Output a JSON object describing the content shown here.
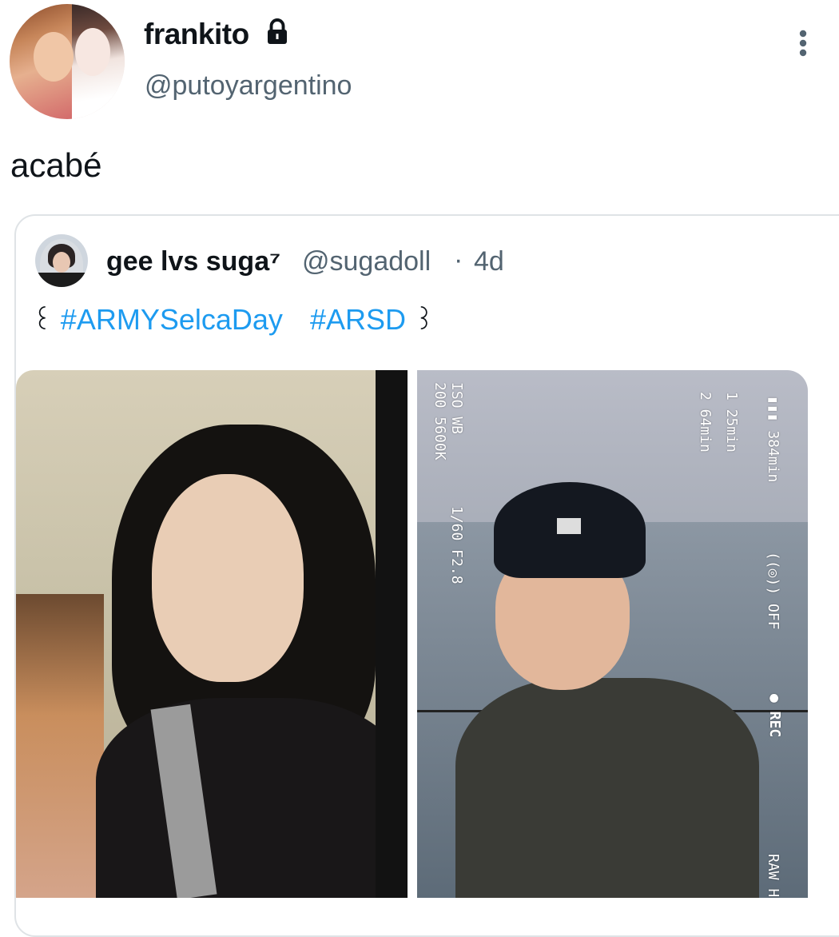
{
  "tweet": {
    "author": {
      "display_name": "frankito",
      "handle": "@putoyargentino",
      "protected_icon": "lock-icon"
    },
    "more_icon": "more-vertical-icon",
    "text": "acabé"
  },
  "quote": {
    "author": {
      "display_name": "gee lvs suga⁷",
      "handle": "@sugadoll",
      "separator": "·",
      "time": "4d"
    },
    "text_parts": {
      "deco_left": "꒰",
      "hashtag_1": "#ARMYSelcaDay",
      "hashtag_2": "#ARSD",
      "deco_right": "꒱"
    },
    "camera_overlay": {
      "iso_wb": "ISO  WB",
      "iso_values": "200  5600K",
      "shutter": "1/60  F2.8",
      "battery": "▮▮▮ 384min",
      "track_1": "1  25min",
      "track_2": "2  64min",
      "stabilizer": "((◎)) OFF",
      "rec": "● REC",
      "raw": "RAW H"
    }
  },
  "colors": {
    "link": "#1d9bf0",
    "secondary_text": "#536471",
    "border": "#dfe3e6"
  }
}
